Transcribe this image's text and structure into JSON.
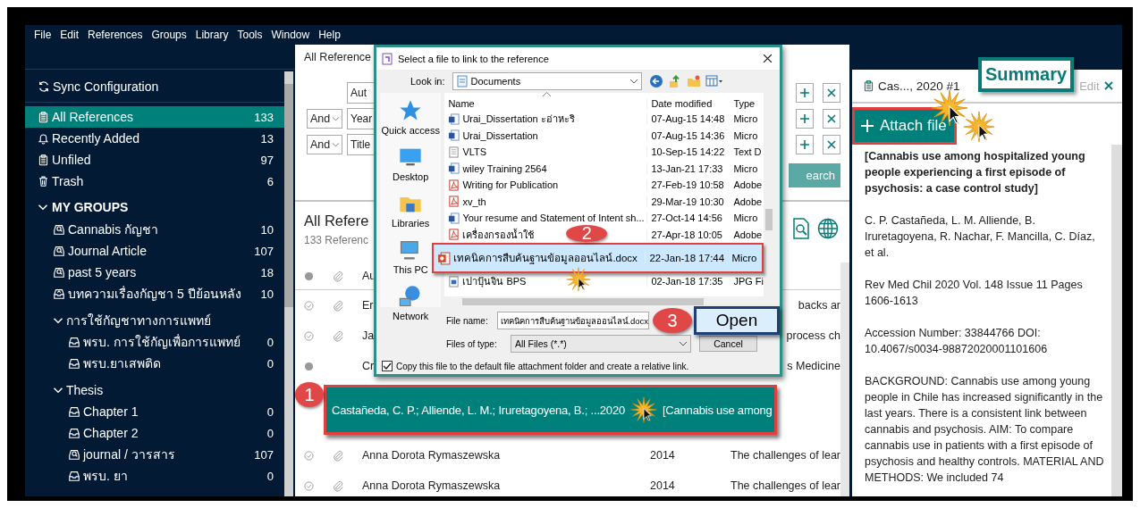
{
  "menu_bar": [
    "File",
    "Edit",
    "References",
    "Groups",
    "Library",
    "Tools",
    "Window",
    "Help"
  ],
  "sidebar": {
    "sync": "Sync Configuration",
    "items": [
      {
        "label": "All References",
        "count": "133",
        "kind": "clipboard",
        "selected": true
      },
      {
        "label": "Recently Added",
        "count": "13",
        "kind": "bell",
        "selected": false
      },
      {
        "label": "Unfiled",
        "count": "97",
        "kind": "clipboard",
        "selected": false
      },
      {
        "label": "Trash",
        "count": "6",
        "kind": "trash",
        "selected": false
      }
    ],
    "groups": {
      "label": "MY GROUPS",
      "expanded": true,
      "children": [
        {
          "label": "Cannabis กัญชา",
          "count": "10",
          "kind": "smart"
        },
        {
          "label": "Journal Article",
          "count": "107",
          "kind": "smart"
        },
        {
          "label": "past 5 years",
          "count": "18",
          "kind": "smart"
        },
        {
          "label": "บทความเรื่องกัญชา 5 ปีย้อนหลัง",
          "count": "10",
          "kind": "shared"
        },
        {
          "label": "การใช้กัญชาทางการแพทย์",
          "kind": "set",
          "expanded": true,
          "children": [
            {
              "label": "พรบ. การใช้กัญเพื่อการแพทย์",
              "count": "0",
              "kind": "group"
            },
            {
              "label": "พรบ.ยาเสพติด",
              "count": "0",
              "kind": "group"
            }
          ]
        },
        {
          "label": "Thesis",
          "kind": "set",
          "expanded": true,
          "children": [
            {
              "label": "Chapter 1",
              "count": "0",
              "kind": "group"
            },
            {
              "label": "Chapter 2",
              "count": "0",
              "kind": "group"
            },
            {
              "label": "journal / วารสาร",
              "count": "107",
              "kind": "smart"
            },
            {
              "label": "พรบ. ยา",
              "count": "0",
              "kind": "group"
            }
          ]
        }
      ]
    }
  },
  "main": {
    "tab": "All Reference",
    "search_rows": [
      {
        "field": "Aut"
      },
      {
        "operator": "And",
        "field": "Year"
      },
      {
        "operator": "And",
        "field": "Title"
      }
    ],
    "search_button": "earch",
    "list_title": "All Refere",
    "list_count": "133 Referenc",
    "header": {
      "author": "Au"
    },
    "rows": [
      {
        "read": true,
        "attachment": true,
        "author": "Er",
        "title": "backs ar",
        "selected": false
      },
      {
        "read": true,
        "attachment": true,
        "author": "Ja",
        "title": "process ch",
        "selected": false
      },
      {
        "read": false,
        "attachment": false,
        "author": "Cr",
        "title": "s Medicine",
        "selected": false
      },
      {
        "author": "Castañeda, C. P.; Alliende, L. M.; Iruretagoyena, B.; ...",
        "year": "2020",
        "title": "[Cannabis use among",
        "selected": true,
        "badge": "1"
      },
      {
        "read": true,
        "attachment": true,
        "author": "Anna Dorota Rymaszewska",
        "year": "2014",
        "title": "The challenges of lear",
        "selected": false
      },
      {
        "read": true,
        "attachment": true,
        "author": "Anna Dorota Rymaszewska",
        "year": "2014",
        "title": "The challenges of lear",
        "selected": false
      }
    ]
  },
  "details": {
    "title": "Cas..., 2020 #1",
    "tabs": [
      {
        "label": "Summary",
        "selected": true
      },
      {
        "label": "Edit",
        "selected": false
      }
    ],
    "attach": "Attach file",
    "paragraphs": [
      {
        "kind": "title",
        "text": "[Cannabis use among hospitalized young people experiencing a first episode of psychosis: a case control study]"
      },
      {
        "kind": "text",
        "text": "C. P. Castañeda, L. M. Alliende, B. Iruretagoyena, R. Nachar, F. Mancilla, C. Díaz, et al."
      },
      {
        "kind": "text",
        "text": "Rev Med Chil 2020 Vol. 148 Issue 11 Pages 1606-1613"
      },
      {
        "kind": "text",
        "text": "Accession Number: 33844766 DOI: 10.4067/s0034-98872020001101606"
      },
      {
        "kind": "text",
        "text": "BACKGROUND: Cannabis use among young people in Chile has increased significantly in the last years. There is a consistent link between cannabis and psychosis. AIM: To compare cannabis use in patients with a first episode of psychosis and healthy controls. MATERIAL AND METHODS: We included 74"
      }
    ]
  },
  "dialog": {
    "title": "Select a file to link to the reference",
    "look_in_label": "Look in:",
    "look_in": "Documents",
    "places": [
      {
        "label": "Quick access",
        "kind": "star"
      },
      {
        "label": "Desktop",
        "kind": "desktop"
      },
      {
        "label": "Libraries",
        "kind": "libraries"
      },
      {
        "label": "This PC",
        "kind": "pc"
      },
      {
        "label": "Network",
        "kind": "network"
      }
    ],
    "columns": [
      "Name",
      "Date modified",
      "Type"
    ],
    "files": [
      {
        "name": "Urai_Dissertation ะอ่าหะริ",
        "modified": "07-Aug-15 14:48",
        "type": "Micro",
        "kind": "word",
        "selected": false
      },
      {
        "name": "Urai_Dissertation",
        "modified": "07-Aug-15 14:36",
        "type": "Micro",
        "kind": "word",
        "selected": false
      },
      {
        "name": "VLTS",
        "modified": "10-Sep-15 14:22",
        "type": "Text D",
        "kind": "text",
        "selected": false
      },
      {
        "name": "wiley Training 2564",
        "modified": "13-Jan-21 17:33",
        "type": "Micro",
        "kind": "word",
        "selected": false
      },
      {
        "name": "Writing for Publication",
        "modified": "27-Feb-19 10:58",
        "type": "Adobe",
        "kind": "pdf",
        "selected": false
      },
      {
        "name": "xv_th",
        "modified": "29-Mar-19 10:30",
        "type": "Adobe",
        "kind": "pdf",
        "selected": false
      },
      {
        "name": "Your resume and Statement of Intent sh...",
        "modified": "27-Oct-14 14:56",
        "type": "Micro",
        "kind": "word",
        "selected": false
      },
      {
        "name": "เครื่องกรองน้ำใช้",
        "modified": "27-Apr-18 10:05",
        "type": "Adobe",
        "kind": "pdf",
        "selected": false
      },
      {
        "name": "เทคนิคการสืบค้นฐานข้อมูลออนไลน์.docx",
        "modified": "22-Jan-18 17:44",
        "type": "Micro",
        "kind": "ppt",
        "selected": true,
        "badge": "2"
      },
      {
        "name": "เปาปุ้นจิน BPS",
        "modified": "02-Jan-18 17:35",
        "type": "JPG Fi",
        "kind": "image",
        "selected": false
      }
    ],
    "file_name_label": "File name:",
    "file_name": "เทคนิคการสืบค้นฐานข้อมูลออนไลน์.docx",
    "file_type_label": "Files of type:",
    "file_type": "All Files (*.*)",
    "open_button": "Open",
    "open_badge": "3",
    "cancel_button": "Cancel",
    "copy_option": {
      "label": "Copy this file to the default file attachment folder and create a relative link.",
      "checked": true
    }
  }
}
